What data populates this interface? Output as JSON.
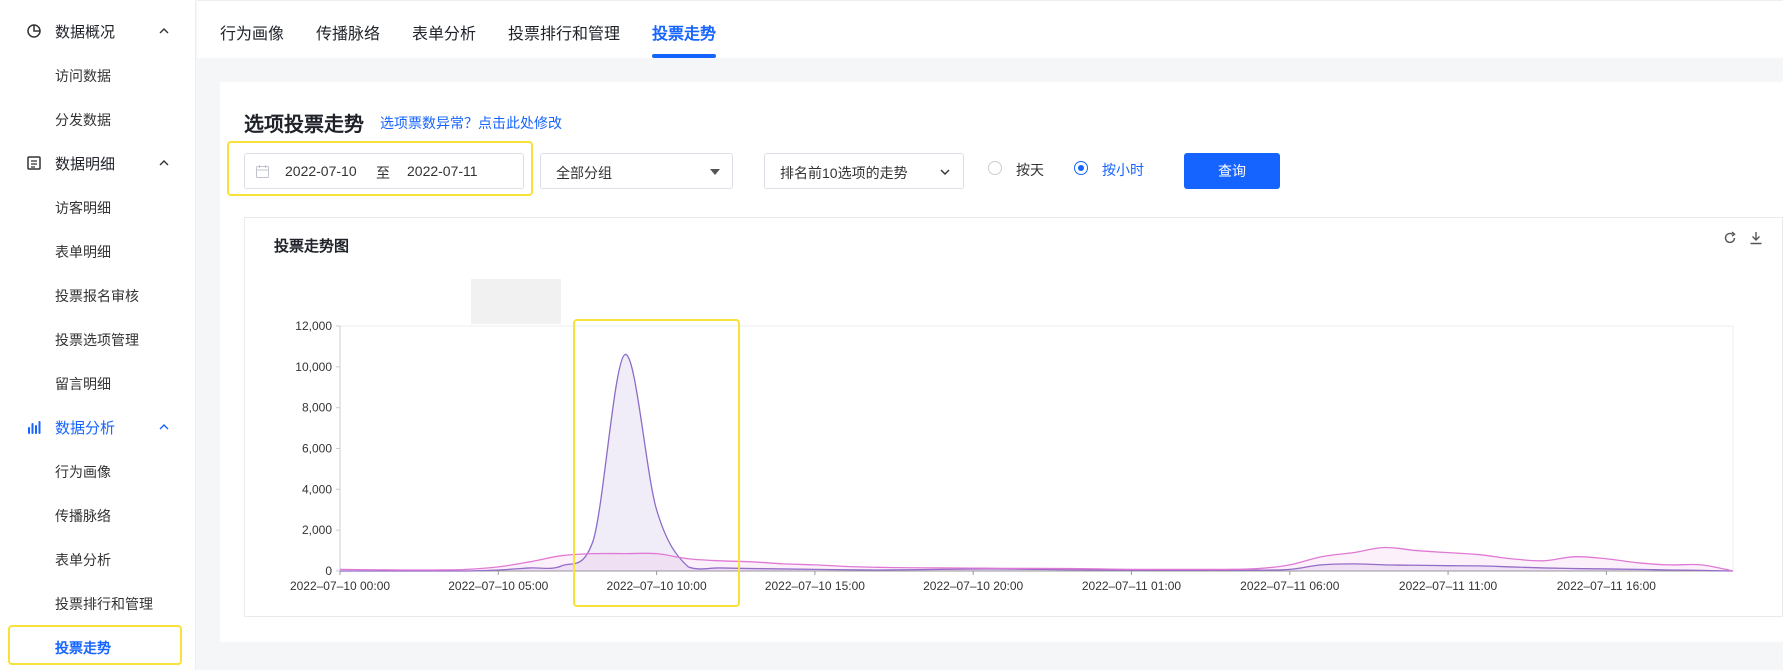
{
  "sidebar": {
    "groups": [
      {
        "label": "数据概况",
        "icon": "pie-chart-icon"
      },
      {
        "label": "数据明细",
        "icon": "list-icon"
      },
      {
        "label": "数据分析",
        "icon": "bar-chart-icon"
      }
    ],
    "items": [
      {
        "label": "访问数据"
      },
      {
        "label": "分发数据"
      },
      {
        "label": "访客明细"
      },
      {
        "label": "表单明细"
      },
      {
        "label": "投票报名审核"
      },
      {
        "label": "投票选项管理"
      },
      {
        "label": "留言明细"
      },
      {
        "label": "行为画像"
      },
      {
        "label": "传播脉络"
      },
      {
        "label": "表单分析"
      },
      {
        "label": "投票排行和管理"
      },
      {
        "label": "投票走势"
      }
    ],
    "active_item": "投票走势"
  },
  "tabs": [
    {
      "label": "行为画像"
    },
    {
      "label": "传播脉络"
    },
    {
      "label": "表单分析"
    },
    {
      "label": "投票排行和管理"
    },
    {
      "label": "投票走势"
    }
  ],
  "active_tab": "投票走势",
  "page": {
    "title": "选项投票走势",
    "modify_link": "选项票数异常？点击此处修改"
  },
  "filters": {
    "date_start": "2022-07-10",
    "date_sep": "至",
    "date_end": "2022-07-11",
    "group_select": "全部分组",
    "trend_select": "排名前10选项的走势",
    "radio_day": "按天",
    "radio_hour": "按小时",
    "radio_selected": "按小时",
    "query_button": "查询"
  },
  "chart_title": "投票走势图",
  "colors": {
    "accent": "#1664ff",
    "highlight": "#f7e13a",
    "series_purple": "#8c6bc8",
    "series_pink": "#e079d6"
  },
  "chart_data": {
    "type": "line",
    "x": [
      "2022-07-10 00:00",
      "2022-07-10 01:00",
      "2022-07-10 02:00",
      "2022-07-10 03:00",
      "2022-07-10 04:00",
      "2022-07-10 05:00",
      "2022-07-10 06:00",
      "2022-07-10 07:00",
      "2022-07-10 08:00",
      "2022-07-10 09:00",
      "2022-07-10 10:00",
      "2022-07-10 11:00",
      "2022-07-10 12:00",
      "2022-07-10 13:00",
      "2022-07-10 14:00",
      "2022-07-10 15:00",
      "2022-07-10 16:00",
      "2022-07-10 17:00",
      "2022-07-10 18:00",
      "2022-07-10 19:00",
      "2022-07-10 20:00",
      "2022-07-10 21:00",
      "2022-07-10 22:00",
      "2022-07-10 23:00",
      "2022-07-11 00:00",
      "2022-07-11 01:00",
      "2022-07-11 02:00",
      "2022-07-11 03:00",
      "2022-07-11 04:00",
      "2022-07-11 05:00",
      "2022-07-11 06:00",
      "2022-07-11 07:00",
      "2022-07-11 08:00",
      "2022-07-11 09:00",
      "2022-07-11 10:00",
      "2022-07-11 11:00",
      "2022-07-11 12:00",
      "2022-07-11 13:00",
      "2022-07-11 14:00",
      "2022-07-11 15:00",
      "2022-07-11 16:00",
      "2022-07-11 17:00",
      "2022-07-11 18:00",
      "2022-07-11 19:00",
      "2022-07-11 20:00"
    ],
    "series": [
      {
        "values": [
          0,
          0,
          0,
          0,
          0,
          50,
          150,
          250,
          1500,
          10600,
          3000,
          200,
          150,
          120,
          100,
          80,
          60,
          50,
          60,
          80,
          100,
          100,
          80,
          60,
          50,
          40,
          30,
          30,
          30,
          40,
          80,
          300,
          350,
          300,
          280,
          260,
          250,
          200,
          150,
          120,
          100,
          80,
          50,
          30,
          0
        ]
      },
      {
        "values": [
          80,
          60,
          50,
          50,
          80,
          200,
          450,
          750,
          850,
          850,
          850,
          600,
          500,
          450,
          350,
          300,
          220,
          180,
          160,
          150,
          140,
          130,
          130,
          120,
          100,
          80,
          80,
          80,
          80,
          120,
          300,
          700,
          900,
          1150,
          1000,
          900,
          800,
          600,
          500,
          700,
          600,
          400,
          300,
          300,
          0
        ]
      }
    ],
    "x_tick_labels": [
      "2022-07-10 00:00",
      "2022-07-10 05:00",
      "2022-07-10 10:00",
      "2022-07-10 15:00",
      "2022-07-10 20:00",
      "2022-07-11 01:00",
      "2022-07-11 06:00",
      "2022-07-11 11:00",
      "2022-07-11 16:00"
    ],
    "y_ticks": [
      "0",
      "2,000",
      "4,000",
      "6,000",
      "8,000",
      "10,000",
      "12,000"
    ],
    "ylim": [
      0,
      12000
    ],
    "grid": false
  }
}
